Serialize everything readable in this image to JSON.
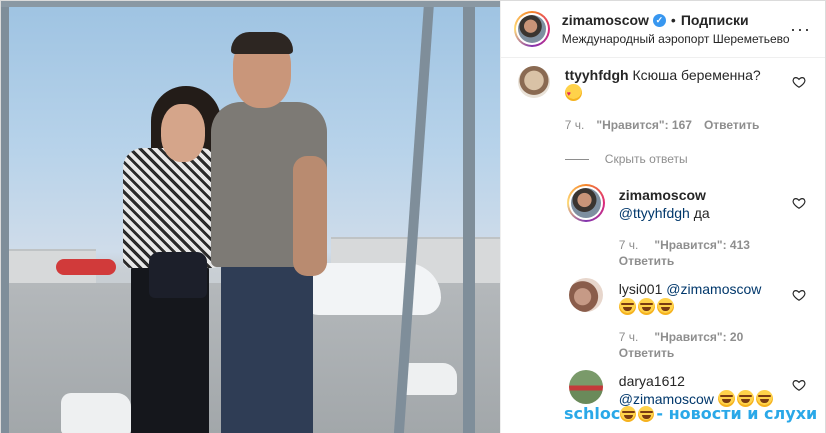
{
  "post": {
    "username": "zimamoscow",
    "verified_mark": "✓",
    "dot": "•",
    "follow_label": "Подписки",
    "location": "Международный аэропорт Шереметьево",
    "more_label": "···"
  },
  "comments": [
    {
      "username": "ttyyhfdgh",
      "text": "Ксюша беременна?",
      "emojis": [
        "love"
      ],
      "time": "7 ч.",
      "likes": "\"Нравится\": 167",
      "reply_label": "Ответить"
    },
    {
      "username": "zimamoscow",
      "mention": "@ttyyhfdgh",
      "text": "да",
      "time": "7 ч.",
      "likes": "\"Нравится\": 413",
      "reply_label": "Ответить"
    },
    {
      "username": "lysi001",
      "mention": "@zimamoscow",
      "emojis": [
        "joy",
        "joy",
        "joy"
      ],
      "time": "7 ч.",
      "likes": "\"Нравится\": 20",
      "reply_label": "Ответить"
    },
    {
      "username": "darya1612",
      "mention": "@zimamoscow",
      "emojis": [
        "joy",
        "joy",
        "joy"
      ]
    }
  ],
  "hide_replies_label": "Скрыть ответы",
  "watermark": {
    "prefix": "schloc",
    "suffix": "- новости и слухи"
  },
  "colors": {
    "mention": "#00376b",
    "secondary": "#8e8e8e",
    "verified": "#3897f0",
    "watermark": "#2aa8e8"
  },
  "icons": {
    "heart": "heart-icon",
    "more": "more-icon"
  }
}
